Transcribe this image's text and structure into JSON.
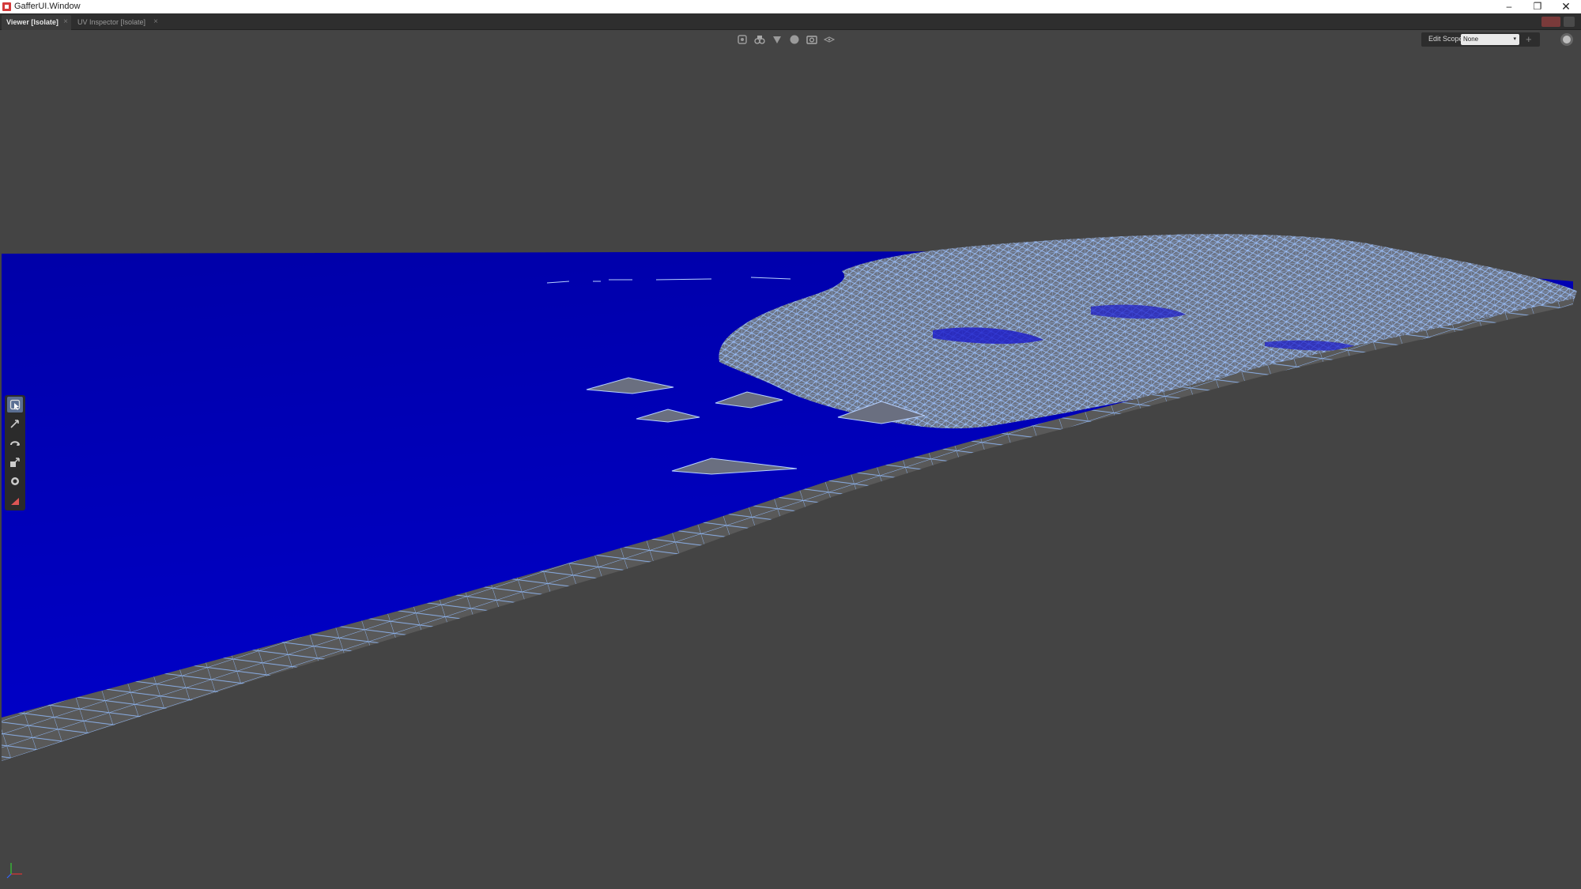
{
  "window": {
    "title": "GafferUI.Window",
    "min_glyph": "–",
    "max_glyph": "❐",
    "close_glyph": "✕"
  },
  "tabs": [
    {
      "label": "Viewer [Isolate]",
      "active": true
    },
    {
      "label": "UV Inspector [Isolate]",
      "active": false
    }
  ],
  "tab_close_glyph": "×",
  "viewport": {
    "toolbar_icons": [
      "camera-settings-icon",
      "scene-gadget-icon",
      "shading-mode-icon",
      "solid-sphere-icon",
      "snapshot-camera-icon",
      "inspector-icon"
    ],
    "edit_scope": {
      "label": "Edit Scope",
      "value": "None",
      "arrow": "▾",
      "plus": "+"
    },
    "tools": [
      "selection-tool-icon",
      "translate-tool-icon",
      "rotate-tool-icon",
      "scale-tool-icon",
      "camera-tool-icon",
      "crop-window-tool-icon"
    ],
    "colors": {
      "background": "#444444",
      "water": "#0000b0",
      "wire": "#8ab4ff",
      "ground": "#5a5a5a"
    }
  }
}
